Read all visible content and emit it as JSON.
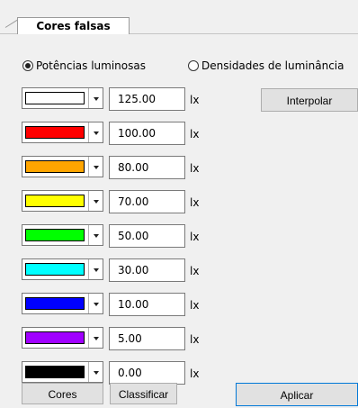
{
  "tab": {
    "title": "Cores falsas"
  },
  "mode": {
    "options": [
      {
        "label": "Potências luminosas",
        "selected": true
      },
      {
        "label": "Densidades de luminância",
        "selected": false
      }
    ]
  },
  "levels": [
    {
      "color": "#ffffff",
      "value": "125.00",
      "unit": "lx"
    },
    {
      "color": "#ff0000",
      "value": "100.00",
      "unit": "lx"
    },
    {
      "color": "#ffa500",
      "value": "80.00",
      "unit": "lx"
    },
    {
      "color": "#ffff00",
      "value": "70.00",
      "unit": "lx"
    },
    {
      "color": "#00ff00",
      "value": "50.00",
      "unit": "lx"
    },
    {
      "color": "#00ffff",
      "value": "30.00",
      "unit": "lx"
    },
    {
      "color": "#0000ff",
      "value": "10.00",
      "unit": "lx"
    },
    {
      "color": "#a000ff",
      "value": "5.00",
      "unit": "lx"
    },
    {
      "color": "#000000",
      "value": "0.00",
      "unit": "lx"
    }
  ],
  "buttons": {
    "interpolate": "Interpolar",
    "colors": "Cores",
    "sort": "Classificar",
    "apply": "Aplicar"
  }
}
